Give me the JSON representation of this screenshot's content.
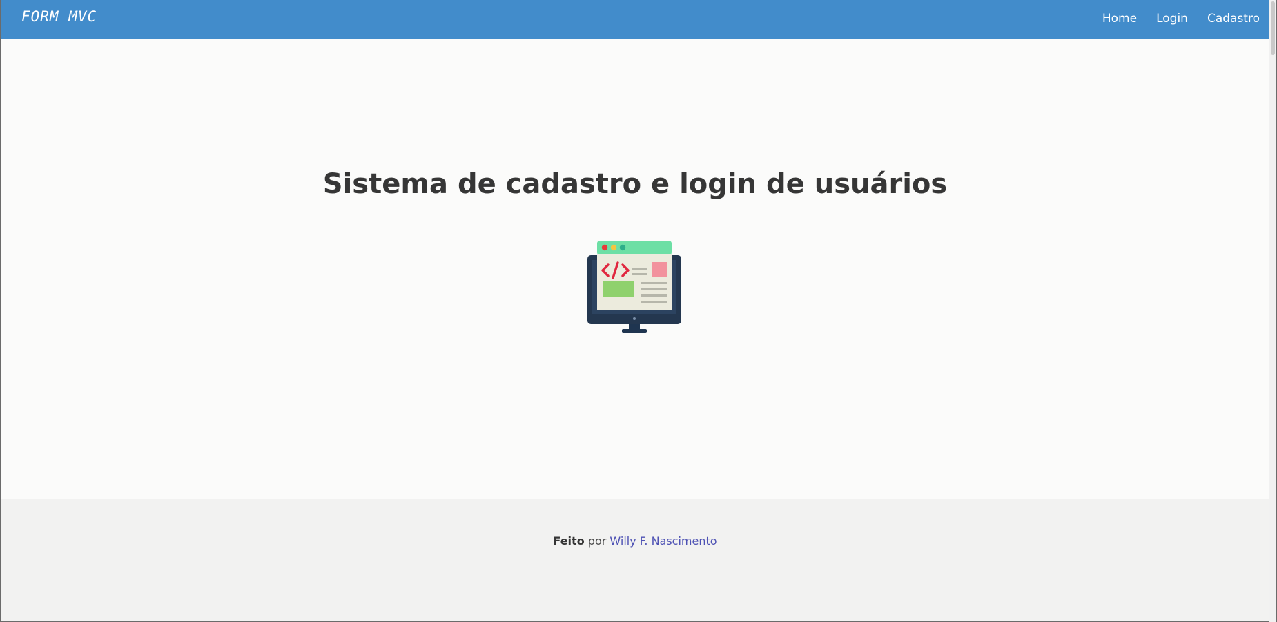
{
  "navbar": {
    "brand": "FORM MVC",
    "links": [
      {
        "label": "Home"
      },
      {
        "label": "Login"
      },
      {
        "label": "Cadastro"
      }
    ],
    "background": "#428ccb"
  },
  "main": {
    "title": "Sistema de cadastro e login de usuários",
    "illustration_icon": "computer-code-window-icon"
  },
  "footer": {
    "made_label": "Feito",
    "by_label": "por",
    "author": "Willy F. Nascimento",
    "author_color": "#4e52b4"
  }
}
